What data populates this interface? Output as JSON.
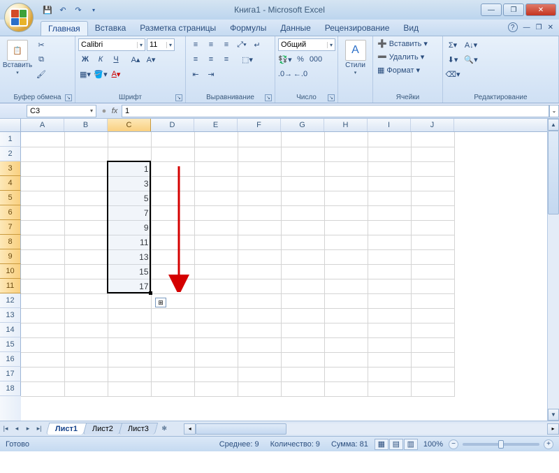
{
  "title": "Книга1 - Microsoft Excel",
  "tabs": [
    "Главная",
    "Вставка",
    "Разметка страницы",
    "Формулы",
    "Данные",
    "Рецензирование",
    "Вид"
  ],
  "active_tab": 0,
  "groups": {
    "clipboard": {
      "label": "Буфер обмена",
      "paste": "Вставить"
    },
    "font": {
      "label": "Шрифт",
      "name": "Calibri",
      "size": "11"
    },
    "align": {
      "label": "Выравнивание"
    },
    "number": {
      "label": "Число",
      "format": "Общий"
    },
    "styles": {
      "label": "Стили",
      "btn": "Стили"
    },
    "cells": {
      "label": "Ячейки",
      "insert": "Вставить",
      "delete": "Удалить",
      "format": "Формат"
    },
    "editing": {
      "label": "Редактирование"
    }
  },
  "namebox": "C3",
  "formula": "1",
  "columns": [
    "A",
    "B",
    "C",
    "D",
    "E",
    "F",
    "G",
    "H",
    "I",
    "J"
  ],
  "selected_col_index": 2,
  "rows": 18,
  "selected_rows": {
    "start": 3,
    "end": 11
  },
  "cell_data": {
    "col": 2,
    "values": {
      "3": "1",
      "4": "3",
      "5": "5",
      "6": "7",
      "7": "9",
      "8": "11",
      "9": "13",
      "10": "15",
      "11": "17"
    }
  },
  "sheets": [
    "Лист1",
    "Лист2",
    "Лист3"
  ],
  "active_sheet": 0,
  "status": {
    "ready": "Готово",
    "avg": "Среднее: 9",
    "count": "Количество: 9",
    "sum": "Сумма: 81",
    "zoom": "100%"
  }
}
